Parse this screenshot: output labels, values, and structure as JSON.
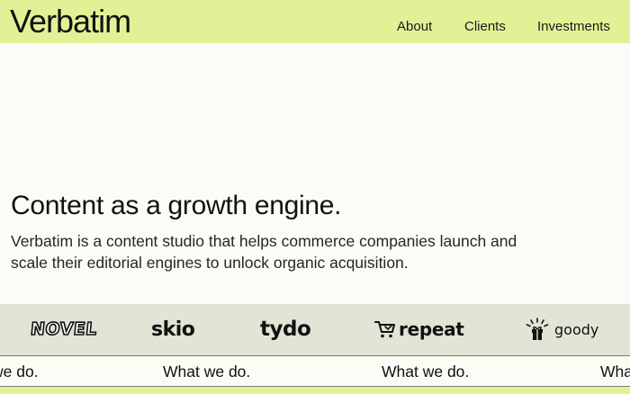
{
  "header": {
    "logo": "Verbatim",
    "nav": [
      {
        "label": "About"
      },
      {
        "label": "Clients"
      },
      {
        "label": "Investments"
      }
    ]
  },
  "hero": {
    "title": "Content as a growth engine.",
    "description": "Verbatim is a content studio that helps commerce companies launch and scale their editorial engines to unlock organic acquisition."
  },
  "client_logos": [
    {
      "name": "NOVEL"
    },
    {
      "name": "skio"
    },
    {
      "name": "tydo"
    },
    {
      "name": "repeat",
      "icon": "cart-icon"
    },
    {
      "name": "goody",
      "icon": "gift-icon"
    }
  ],
  "ticker": {
    "items": [
      "we do.",
      "What we do.",
      "What we do.",
      "Wha"
    ]
  },
  "colors": {
    "accent_lime": "#e1f296",
    "background_cream": "#fdfbf5",
    "logo_band": "#e3e3d6",
    "text": "#111111"
  }
}
